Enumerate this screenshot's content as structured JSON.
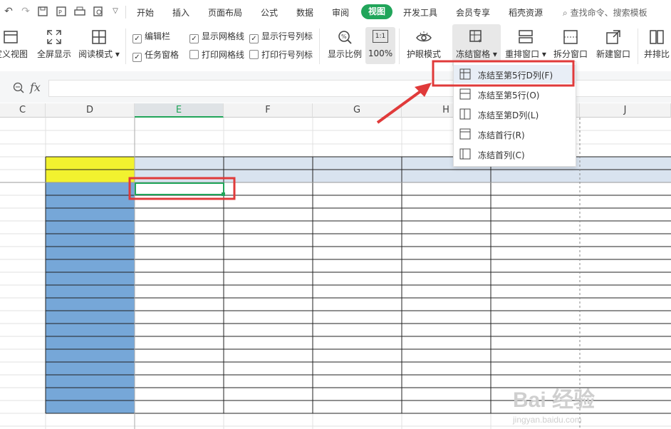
{
  "quick_access": [
    "undo-icon",
    "redo-icon",
    "save-icon",
    "export-icon",
    "print-icon",
    "print-preview-icon",
    "more-dropdown-icon"
  ],
  "menu": {
    "items": [
      "开始",
      "插入",
      "页面布局",
      "公式",
      "数据",
      "审阅",
      "视图",
      "开发工具",
      "会员专享",
      "稻壳资源"
    ],
    "active": "视图",
    "search_placeholder": "查找命令、搜索模板"
  },
  "ribbon": {
    "custom_view": "定义视图",
    "fullscreen": "全屏显示",
    "reading_mode": "阅读模式",
    "checkboxes": [
      {
        "label": "编辑栏",
        "checked": true
      },
      {
        "label": "显示网格线",
        "checked": true
      },
      {
        "label": "显示行号列标",
        "checked": true
      },
      {
        "label": "任务窗格",
        "checked": true
      },
      {
        "label": "打印网格线",
        "checked": false
      },
      {
        "label": "打印行号列标",
        "checked": false
      }
    ],
    "zoom_ratio": "显示比例",
    "zoom_100": "100%",
    "zoom_icon_text": "1:1",
    "eye_mode": "护眼模式",
    "freeze": "冻结窗格",
    "rearrange": "重排窗口",
    "split": "拆分窗口",
    "new_window": "新建窗口",
    "side_by_side": "并排比"
  },
  "formula_bar": {
    "fx": "fx",
    "value": ""
  },
  "columns": [
    "C",
    "D",
    "E",
    "F",
    "G",
    "H",
    "J"
  ],
  "selected_column": "E",
  "freeze_menu": [
    {
      "label": "冻结至第5行D列(F)",
      "highlighted": true
    },
    {
      "label": "冻结至第5行(O)",
      "highlighted": false
    },
    {
      "label": "冻结至第D列(L)",
      "highlighted": false
    },
    {
      "label": "冻结首行(R)",
      "highlighted": false
    },
    {
      "label": "冻结首列(C)",
      "highlighted": false
    }
  ],
  "colors": {
    "accent": "#21a55a",
    "highlight_red": "#e03a3a",
    "yellow": "#f2f22f",
    "blue": "#76a7d8",
    "header_blue": "#d9e3ef"
  },
  "watermark": "Baidu经验 jingyan.baidu.com"
}
